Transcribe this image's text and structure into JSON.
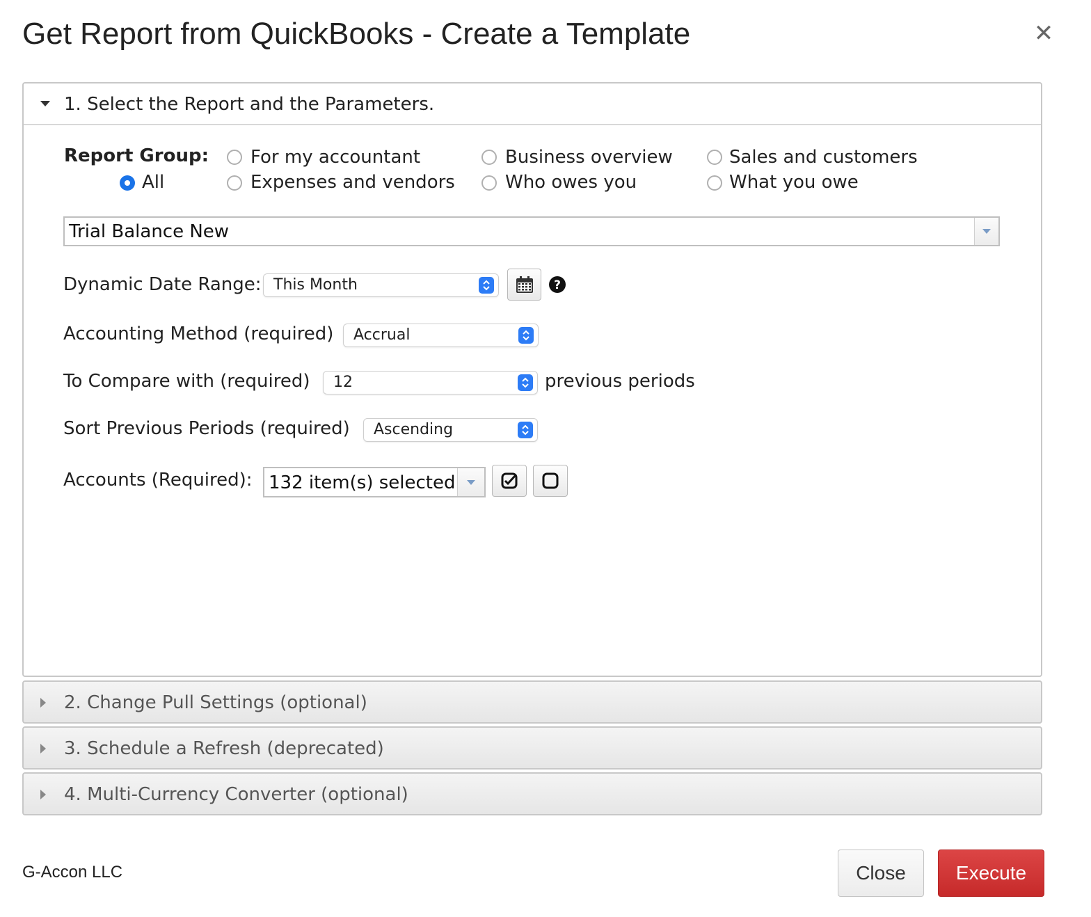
{
  "dialog": {
    "title": "Get Report from QuickBooks - Create a Template",
    "close_icon": "close-icon"
  },
  "sections": [
    {
      "label": "1. Select the Report and the Parameters.",
      "expanded": true
    },
    {
      "label": "2. Change Pull Settings (optional)",
      "expanded": false
    },
    {
      "label": "3. Schedule a Refresh (deprecated)",
      "expanded": false
    },
    {
      "label": "4. Multi-Currency Converter (optional)",
      "expanded": false
    }
  ],
  "report_group": {
    "label": "Report Group:",
    "selected": "All",
    "options": [
      "All",
      "For my accountant",
      "Expenses and vendors",
      "Business overview",
      "Who owes you",
      "Sales and customers",
      "What you owe"
    ]
  },
  "report": {
    "value": "Trial Balance New"
  },
  "date_range": {
    "label": "Dynamic Date Range:",
    "value": "This Month",
    "calendar_icon": "calendar-icon",
    "help_icon": "help-icon"
  },
  "accounting_method": {
    "label": "Accounting Method (required)",
    "value": "Accrual"
  },
  "compare": {
    "label": "To Compare with (required)",
    "value": "12",
    "suffix": "previous periods"
  },
  "sort_periods": {
    "label": "Sort Previous Periods (required)",
    "value": "Ascending"
  },
  "accounts": {
    "label": "Accounts (Required):",
    "value": "132 item(s) selected",
    "select_all_icon": "check-square-icon",
    "clear_icon": "square-icon"
  },
  "footer": {
    "company": "G-Accon LLC",
    "close_label": "Close",
    "execute_label": "Execute"
  },
  "colors": {
    "accent": "#2d7cf6",
    "execute": "#c62a2a"
  }
}
